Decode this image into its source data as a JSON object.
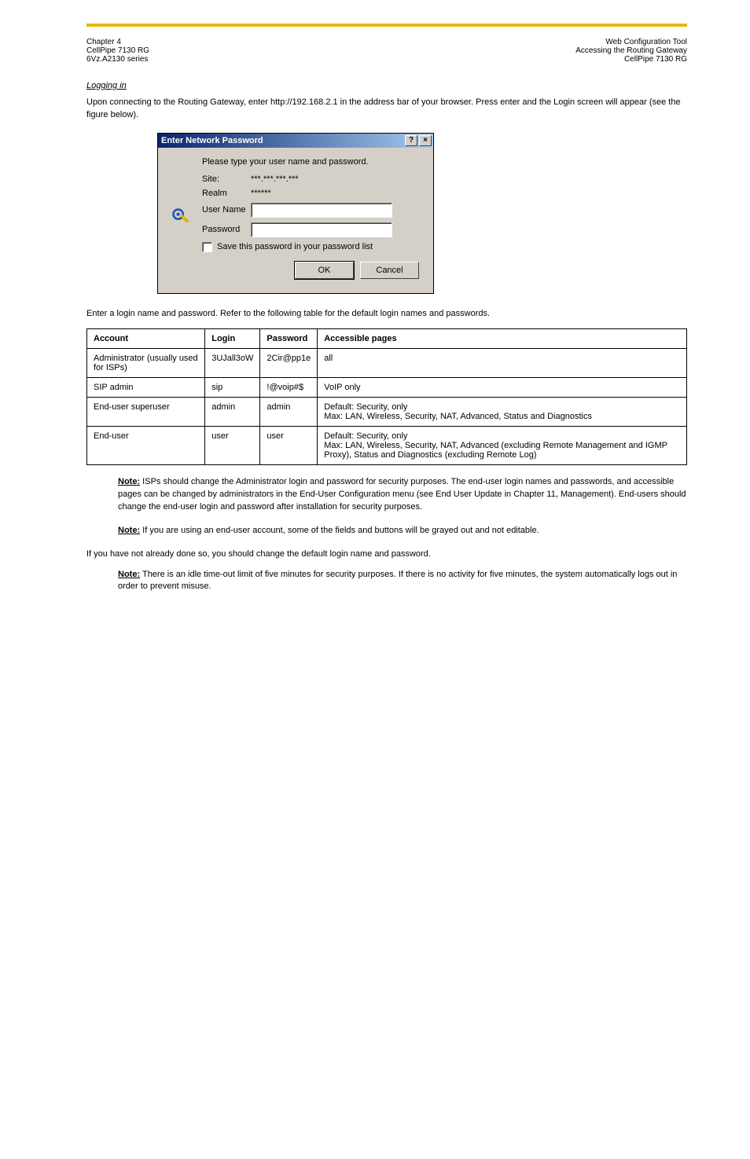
{
  "header": {
    "left": "Chapter 4",
    "center_1": "CellPipe 7130 RG",
    "center_2": "6Vz.A2130 series",
    "right_1": "Web Configuration Tool",
    "right_2": "Accessing the Routing Gateway",
    "right_3": "CellPipe 7130 RG"
  },
  "section1": {
    "title": "Logging in",
    "p1": "Upon connecting to the Routing Gateway, enter http://192.168.2.1 in the address bar of your browser. Press enter and the Login screen will appear (see the figure below).",
    "p2": "Enter a login name and password. Refer to the following table for the default login names and passwords."
  },
  "dialog": {
    "title": "Enter Network Password",
    "help": "?",
    "close": "×",
    "prompt": "Please type your user name and password.",
    "site_label": "Site:",
    "site_value": "***.***.***.***",
    "realm_label": "Realm",
    "realm_value": "******",
    "user_label": "User Name",
    "pass_label": "Password",
    "save_label": "Save this password in your password list",
    "ok": "OK",
    "cancel": "Cancel"
  },
  "table": {
    "headers": [
      "Account",
      "Login",
      "Password",
      "Accessible pages"
    ],
    "rows": [
      {
        "account": "Administrator (usually used for ISPs)",
        "login": "3UJall3oW",
        "password": "2Cir@pp1e",
        "pages": "all"
      },
      {
        "account": "SIP admin",
        "login": "sip",
        "password": "!@voip#$",
        "pages": "VoIP only"
      },
      {
        "account": "End-user superuser",
        "login": "admin",
        "password": "admin",
        "pages": "Default: Security, only\nMax: LAN, Wireless, Security, NAT, Advanced, Status and Diagnostics"
      },
      {
        "account": "End-user",
        "login": "user",
        "password": "user",
        "pages": "Default: Security, only\nMax: LAN, Wireless, Security, NAT, Advanced (excluding Remote Management and IGMP Proxy), Status and Diagnostics (excluding Remote Log)"
      }
    ]
  },
  "notes": {
    "note1_lead": "Note:",
    "note1_body": "ISPs should change the Administrator login and password for security purposes. The end-user login names and passwords, and accessible pages can be changed by administrators in the End-User Configuration menu (see End User Update in Chapter 11, Management). End-users should change the end-user login and password after installation for security purposes.",
    "note2_lead": "Note:",
    "note2_body": "If you are using an end-user account, some of the fields and buttons will be grayed out and not editable.",
    "p_after": "If you have not already done so, you should change the default login name and password.",
    "note3_lead": "Note:",
    "note3_body": "There is an idle time-out limit of five minutes for security purposes. If there is no activity for five minutes, the system automatically logs out in order to prevent misuse."
  }
}
